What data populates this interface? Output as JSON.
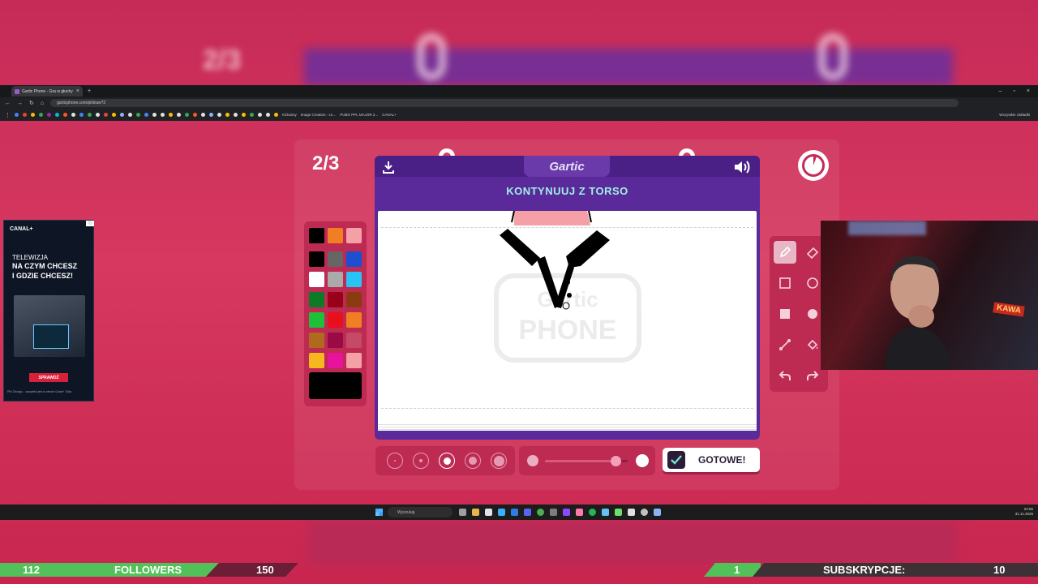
{
  "browser": {
    "tab_title": "Gartic Phone - Gra w głuchy tel...",
    "url": "garticphone.com/pl/draw?2",
    "bookmarks": [
      "Kickassy",
      "Image Creation - Le...",
      "PUBG PPL MAJOR 2...",
      "CANAL+"
    ],
    "bookmarks_right": "Wszystkie zakładki"
  },
  "game": {
    "round": "2/3",
    "logo": "Gartic",
    "prompt": "KONTYNUUJ Z TORSO",
    "watermark_top": "Gartic",
    "watermark_bottom": "PHONE",
    "done_label": "GOTOWE!",
    "opacity_level": 0.85,
    "selected_size_index": 2,
    "selected_color": "#000000"
  },
  "palette": {
    "colors": [
      [
        "#000000",
        "#f07f24",
        "#f4a0a6"
      ],
      [
        "#000000",
        "#666666",
        "#1e4fd1"
      ],
      [
        "#ffffff",
        "#aaaaaa",
        "#29c4f5"
      ],
      [
        "#0c7a26",
        "#99001a",
        "#8a3b10"
      ],
      [
        "#1ec03a",
        "#e8101c",
        "#f07f24"
      ],
      [
        "#b06a1e",
        "#9a0a44",
        "#c44a66"
      ],
      [
        "#f5b81e",
        "#e8129c",
        "#f4a0a6"
      ]
    ]
  },
  "tools": [
    "pencil-icon",
    "eraser-icon",
    "rect-outline-icon",
    "ellipse-outline-icon",
    "rect-fill-icon",
    "ellipse-fill-icon",
    "line-icon",
    "fill-bucket-icon",
    "undo-icon",
    "redo-icon"
  ],
  "ad": {
    "brand": "CANAL+",
    "line1": "TELEWIZJA",
    "line2": "NA CZYM CHCESZ",
    "line3": "I GDZIE CHCESZ!",
    "cta": "SPRAWDŹ",
    "fine_print": "PIN Zbudgo... wszystko jest w ofercie Canal+ Tylko"
  },
  "webcam": {
    "sign": "KAWA"
  },
  "taskbar": {
    "search_placeholder": "Wyszukaj",
    "time": "22:55",
    "date": "31.11.2026"
  },
  "overlay": {
    "followers_count": "112",
    "followers_label": "FOLLOWERS",
    "followers_goal": "150",
    "subs_count": "1",
    "subs_label": "SUBSKRYPCJE:",
    "subs_goal": "10"
  },
  "colors": {
    "accent_purple": "#5b2a9a",
    "prompt_cyan": "#9ff0e4",
    "panel_red": "#bd2a52",
    "overlay_green": "#52c15a"
  }
}
